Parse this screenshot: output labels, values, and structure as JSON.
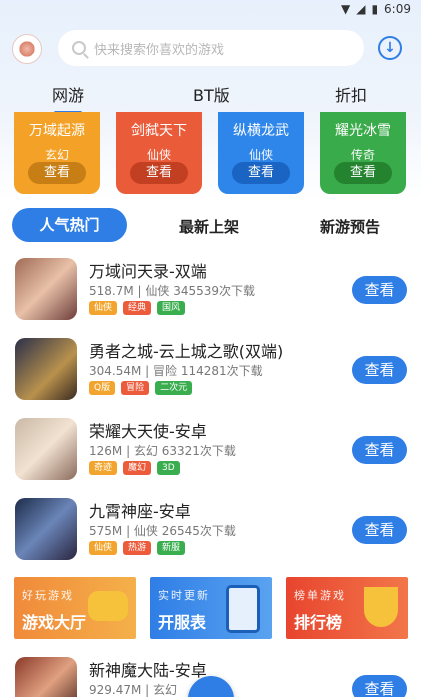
{
  "status": {
    "time": "6:09"
  },
  "search": {
    "placeholder": "快来搜索你喜欢的游戏"
  },
  "category_tabs": [
    "网游",
    "BT版",
    "折扣"
  ],
  "featured": [
    {
      "name": "万域起源",
      "genre": "玄幻",
      "button": "查看",
      "color": "#f3a227"
    },
    {
      "name": "剑弑天下",
      "genre": "仙侠",
      "button": "查看",
      "color": "#ea5b3a"
    },
    {
      "name": "纵横龙武",
      "genre": "仙侠",
      "button": "查看",
      "color": "#2f86ea"
    },
    {
      "name": "耀光冰雪",
      "genre": "传奇",
      "button": "查看",
      "color": "#3aab4a"
    }
  ],
  "sub_tabs": [
    "人气热门",
    "最新上架",
    "新游预告"
  ],
  "games": [
    {
      "title": "万域问天录-双端",
      "meta": "518.7M | 仙侠  345539次下载",
      "tags": [
        "仙侠",
        "经典",
        "国风"
      ],
      "button": "查看"
    },
    {
      "title": "勇者之城-云上城之歌(双端)",
      "meta": "304.54M | 冒险  114281次下载",
      "tags": [
        "Q版",
        "冒险",
        "二次元"
      ],
      "button": "查看"
    },
    {
      "title": "荣耀大天使-安卓",
      "meta": "126M | 玄幻  63321次下载",
      "tags": [
        "奇迹",
        "魔幻",
        "3D"
      ],
      "button": "查看"
    },
    {
      "title": "九霄神座-安卓",
      "meta": "575M | 仙侠  26545次下载",
      "tags": [
        "仙侠",
        "热游",
        "新服"
      ],
      "button": "查看"
    },
    {
      "title": "新神魔大陆-安卓",
      "meta": "929.47M | 玄幻",
      "tags": [],
      "button": "查看"
    }
  ],
  "banners": [
    {
      "small": "好玩游戏",
      "big": "游戏大厅",
      "color": "#f09a3a"
    },
    {
      "small": "实时更新",
      "big": "开服表",
      "color": "#3d8ee9"
    },
    {
      "small": "榜单游戏",
      "big": "排行榜",
      "color": "#ee5d3c"
    }
  ],
  "tag_colors": {
    "0": "#f2a52e",
    "1": "#ec5c3c",
    "2": "#3aae4f"
  }
}
